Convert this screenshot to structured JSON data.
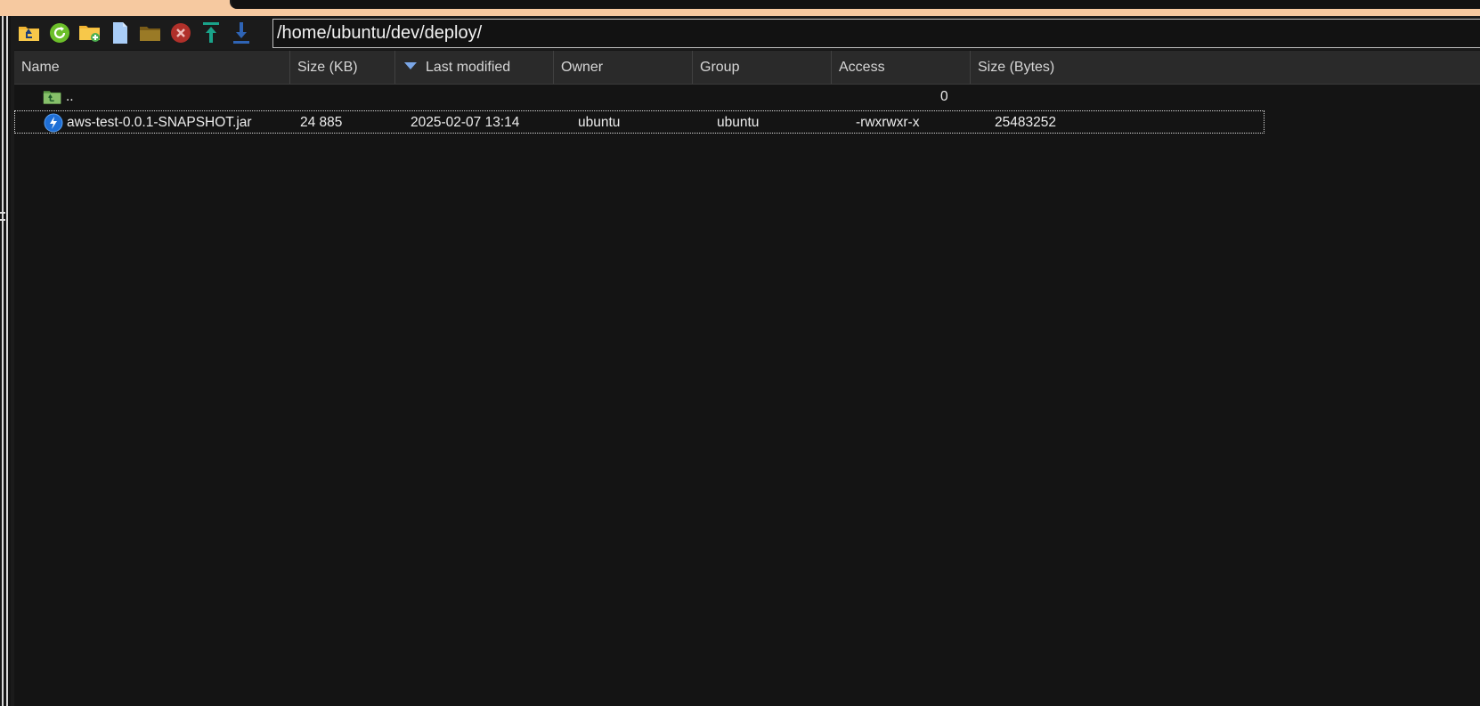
{
  "toolbar": {
    "buttons": [
      {
        "name": "parent-folder-icon",
        "color": "#f2b531"
      },
      {
        "name": "refresh-icon",
        "color": "#6cbf2a"
      },
      {
        "name": "new-folder-icon",
        "color": "#f2b531"
      },
      {
        "name": "new-file-icon",
        "color": "#a9cdf7"
      },
      {
        "name": "folder-icon",
        "color": "#8a6a1e"
      },
      {
        "name": "delete-icon",
        "color": "#b0302a"
      },
      {
        "name": "upload-icon",
        "color": "#1aa38a"
      },
      {
        "name": "download-icon",
        "color": "#2f64b5"
      }
    ],
    "path": "/home/ubuntu/dev/deploy/"
  },
  "columns": {
    "name": "Name",
    "size_kb": "Size (KB)",
    "last_modified": "Last modified",
    "owner": "Owner",
    "group": "Group",
    "access": "Access",
    "size_bytes": "Size (Bytes)"
  },
  "rows": [
    {
      "name": "..",
      "icon": "parent-directory-icon",
      "size_kb": "",
      "last_modified": "",
      "owner": "",
      "group": "",
      "access": "",
      "size_bytes": "0"
    },
    {
      "name": "aws-test-0.0.1-SNAPSHOT.jar",
      "icon": "jar-file-icon",
      "size_kb": "24 885",
      "last_modified": "2025-02-07 13:14",
      "owner": "ubuntu",
      "group": "ubuntu",
      "access": "-rwxrwxr-x",
      "size_bytes": "25483252"
    }
  ],
  "sort": {
    "column": "last_modified",
    "direction": "descending"
  }
}
